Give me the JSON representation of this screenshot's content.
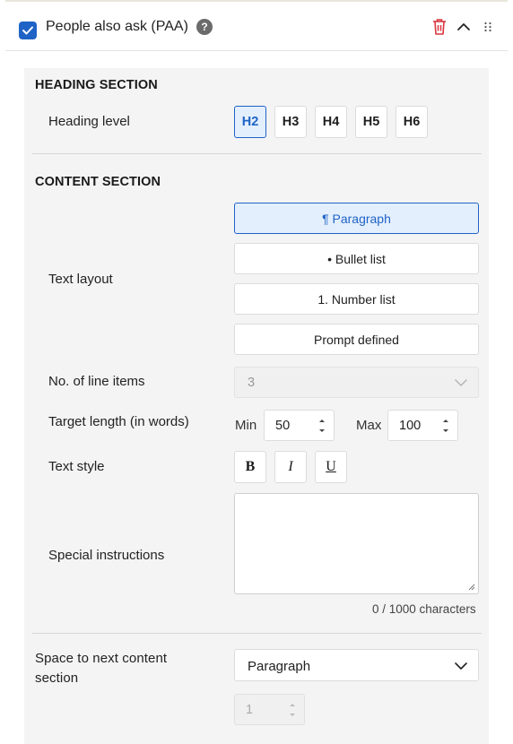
{
  "header": {
    "checked": true,
    "title": "People also ask (PAA)",
    "help_icon": "question-circle-icon",
    "delete_icon": "trash-icon",
    "collapse_icon": "chevron-up-icon",
    "drag_icon": "drag-handle-icon"
  },
  "heading_section": {
    "title": "HEADING SECTION",
    "level_label": "Heading level",
    "levels": [
      "H2",
      "H3",
      "H4",
      "H5",
      "H6"
    ],
    "selected_level": "H2"
  },
  "content_section": {
    "title": "CONTENT SECTION",
    "text_layout_label": "Text layout",
    "layouts": [
      "¶ Paragraph",
      "• Bullet list",
      "1. Number list",
      "Prompt defined"
    ],
    "selected_layout": "¶ Paragraph",
    "line_items_label": "No. of line items",
    "line_items_value": "3",
    "target_length_label": "Target length (in words)",
    "min_label": "Min",
    "min_value": "50",
    "max_label": "Max",
    "max_value": "100",
    "text_style_label": "Text style",
    "styles": [
      "B",
      "I",
      "U"
    ],
    "special_instructions_label": "Special instructions",
    "special_instructions_value": "",
    "char_counter": "0 / 1000 characters"
  },
  "spacing": {
    "label_line1": "Space to next content",
    "label_line2": "section",
    "selected": "Paragraph",
    "count_value": "1"
  },
  "colors": {
    "accent": "#1f63c6",
    "accent_bg": "#e3effd",
    "danger": "#d9363e",
    "panel_bg": "#f4f4f4"
  }
}
